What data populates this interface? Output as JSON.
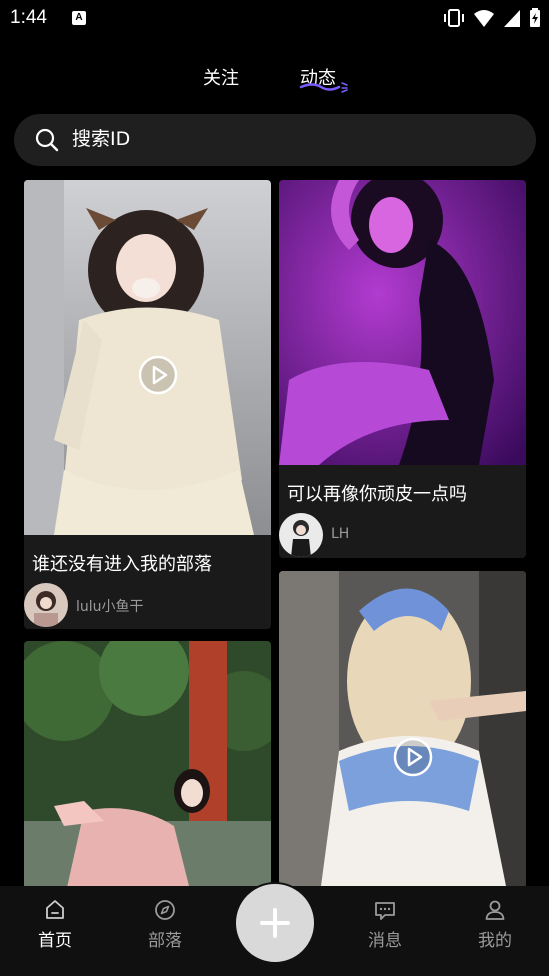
{
  "status_bar": {
    "time": "1:44",
    "notification_glyph": "A"
  },
  "top_tabs": {
    "follow": "关注",
    "dynamic": "动态",
    "active": "dynamic"
  },
  "search": {
    "placeholder": "搜索ID"
  },
  "feed": {
    "cards": [
      {
        "title": "谁还没有进入我的部落",
        "author": "lulu小鱼干",
        "is_video": true
      },
      {
        "title": "可以再像你顽皮一点吗",
        "author": "LH",
        "is_video": false
      },
      {
        "title": "",
        "author": "",
        "is_video": false
      },
      {
        "title": "",
        "author": "",
        "is_video": true
      }
    ]
  },
  "bottom_nav": {
    "items": [
      {
        "label": "首页",
        "icon": "home-icon",
        "active": true
      },
      {
        "label": "部落",
        "icon": "compass-icon",
        "active": false
      },
      {
        "label": "消息",
        "icon": "message-icon",
        "active": false
      },
      {
        "label": "我的",
        "icon": "user-icon",
        "active": false
      }
    ],
    "fab_icon": "plus-icon"
  },
  "colors": {
    "background": "#000000",
    "search_bg": "#1f1f1f",
    "card_bg": "#1a1a1a",
    "nav_bg": "#101010",
    "accent": "#7b5cff"
  }
}
